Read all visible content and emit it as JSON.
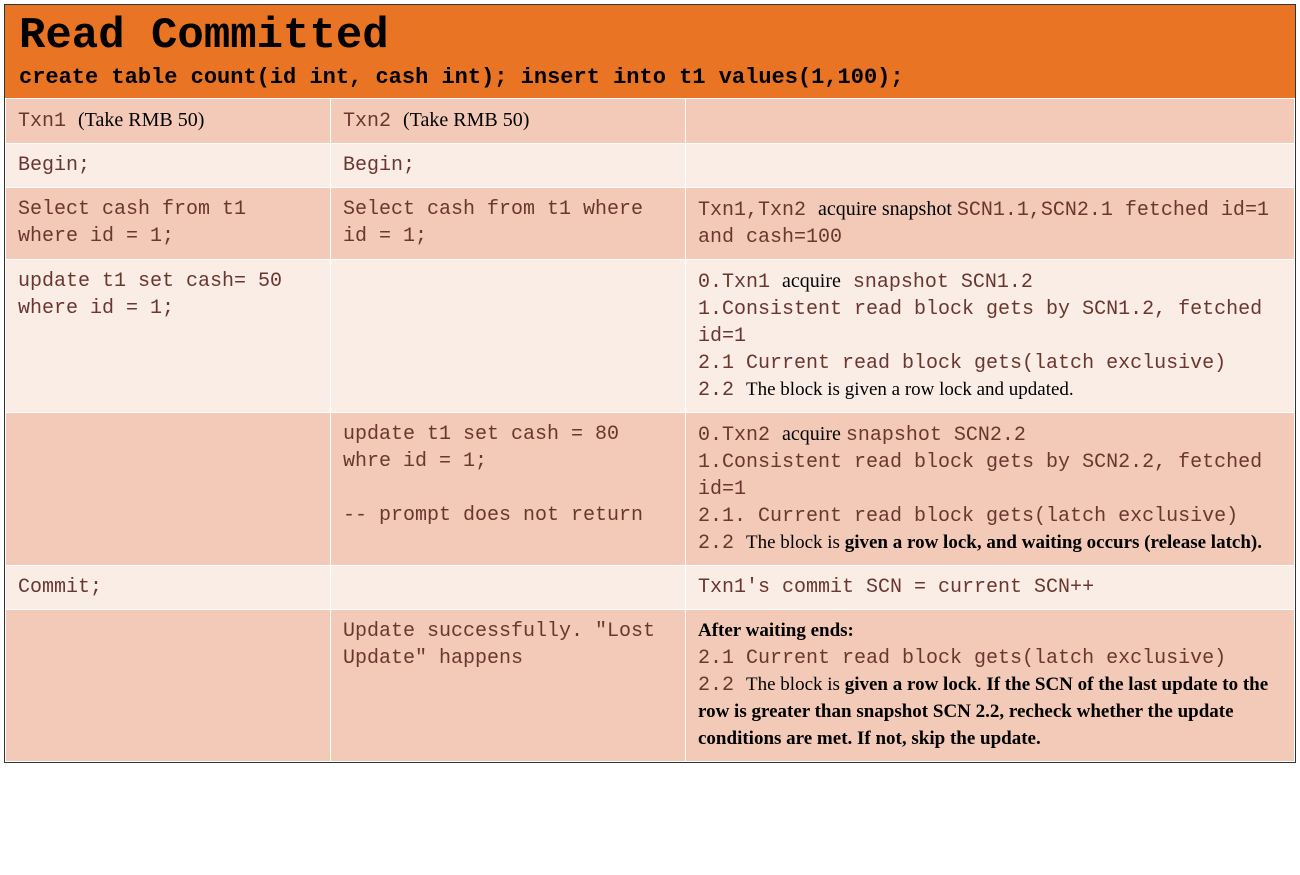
{
  "header": {
    "title": "Read Committed",
    "subtitle": "create table count(id int, cash int); insert into t1 values(1,100);"
  },
  "rows": {
    "r0": {
      "c1a": "Txn1 ",
      "c1b": "(Take RMB 50)",
      "c2a": "Txn2 ",
      "c2b": "(Take RMB 50)",
      "c3": ""
    },
    "r1": {
      "c1": "Begin;",
      "c2": "Begin;",
      "c3": ""
    },
    "r2": {
      "c1": "Select cash from t1 where id = 1;",
      "c2": "Select cash from t1 where id = 1;",
      "c3a": "Txn1,Txn2 ",
      "c3b": "acquire snapshot ",
      "c3c": "SCN1.1,SCN2.1 fetched id=1 and cash=100"
    },
    "r3": {
      "c1": "update t1 set cash= 50 where id = 1;",
      "c2": "",
      "c3_0a": "0.Txn1  ",
      "c3_0b": "acquire",
      "c3_0c": "  snapshot SCN1.2",
      "c3_1": "1.Consistent read block gets by SCN1.2, fetched id=1",
      "c3_21": "2.1 Current read block gets(latch exclusive)",
      "c3_22a": "2.2 ",
      "c3_22b": "The block is given a row lock and updated."
    },
    "r4": {
      "c1": "",
      "c2_a": "update t1 set cash = 80 whre id = 1;",
      "c2_b": "-- prompt does not return",
      "c3_0a": "0.Txn2  ",
      "c3_0b": "acquire ",
      "c3_0c": "snapshot SCN2.2",
      "c3_1": "1.Consistent read block gets by SCN2.2, fetched id=1",
      "c3_21": "2.1. Current read block gets(latch exclusive)",
      "c3_22a": "2.2   ",
      "c3_22b": "The block is ",
      "c3_22c": "given a row lock, and ",
      "c3_22d": "waiting occurs (release latch)."
    },
    "r5": {
      "c1": "Commit;",
      "c2": "",
      "c3": "Txn1's commit SCN = current SCN++"
    },
    "r6": {
      "c1": "",
      "c2": "Update successfully. \"Lost Update\" happens",
      "c3_h": "After waiting ends:",
      "c3_21": "2.1 Current read block gets(latch exclusive)",
      "c3_22a": "2.2 ",
      "c3_22b": "The block is ",
      "c3_22c": "given a row lock",
      "c3_22d": ". ",
      "c3_22e": "If the SCN of the last update to the row is greater than snapshot SCN 2.2, recheck whether the update conditions are met. If not, skip the update."
    }
  }
}
